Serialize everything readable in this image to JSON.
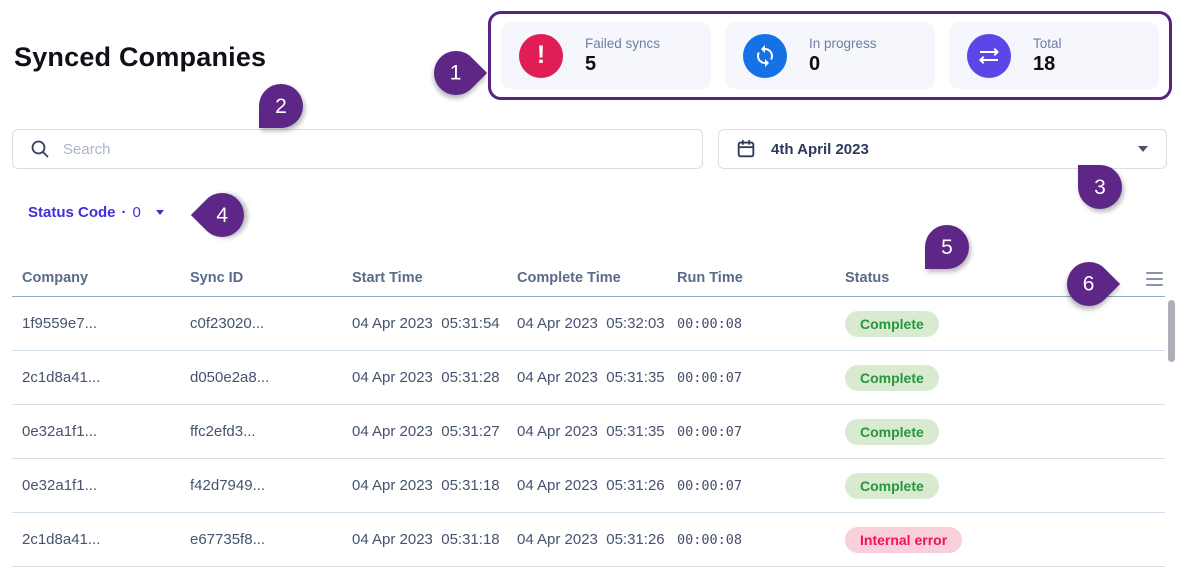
{
  "page": {
    "title": "Synced Companies"
  },
  "stats": {
    "cards": [
      {
        "label": "Failed syncs",
        "value": "5",
        "icon": "alert-icon",
        "color": "#e11d55"
      },
      {
        "label": "In progress",
        "value": "0",
        "icon": "sync-icon",
        "color": "#1472e6"
      },
      {
        "label": "Total",
        "value": "18",
        "icon": "transfer-icon",
        "color": "#5b46e8"
      }
    ]
  },
  "search": {
    "placeholder": "Search"
  },
  "date_picker": {
    "value": "4th April 2023"
  },
  "filters": {
    "status_code": {
      "label": "Status Code",
      "separator": "·",
      "count": "0"
    }
  },
  "table": {
    "columns": {
      "company": "Company",
      "sync_id": "Sync ID",
      "start_time": "Start Time",
      "complete_time": "Complete Time",
      "run_time": "Run Time",
      "status": "Status"
    },
    "rows": [
      {
        "company": "1f9559e7...",
        "sync_id": "c0f23020...",
        "start": "04 Apr 2023  05:31:54",
        "complete": "04 Apr 2023  05:32:03",
        "run_time": "00:00:08",
        "status": "Complete",
        "status_type": "success"
      },
      {
        "company": "2c1d8a41...",
        "sync_id": "d050e2a8...",
        "start": "04 Apr 2023  05:31:28",
        "complete": "04 Apr 2023  05:31:35",
        "run_time": "00:00:07",
        "status": "Complete",
        "status_type": "success"
      },
      {
        "company": "0e32a1f1...",
        "sync_id": "ffc2efd3...",
        "start": "04 Apr 2023  05:31:27",
        "complete": "04 Apr 2023  05:31:35",
        "run_time": "00:00:07",
        "status": "Complete",
        "status_type": "success"
      },
      {
        "company": "0e32a1f1...",
        "sync_id": "f42d7949...",
        "start": "04 Apr 2023  05:31:18",
        "complete": "04 Apr 2023  05:31:26",
        "run_time": "00:00:07",
        "status": "Complete",
        "status_type": "success"
      },
      {
        "company": "2c1d8a41...",
        "sync_id": "e67735f8...",
        "start": "04 Apr 2023  05:31:18",
        "complete": "04 Apr 2023  05:31:26",
        "run_time": "00:00:08",
        "status": "Internal error",
        "status_type": "error"
      }
    ]
  },
  "annotations": {
    "color": "#5e2686",
    "markers": [
      "1",
      "2",
      "3",
      "4",
      "5",
      "6"
    ]
  }
}
